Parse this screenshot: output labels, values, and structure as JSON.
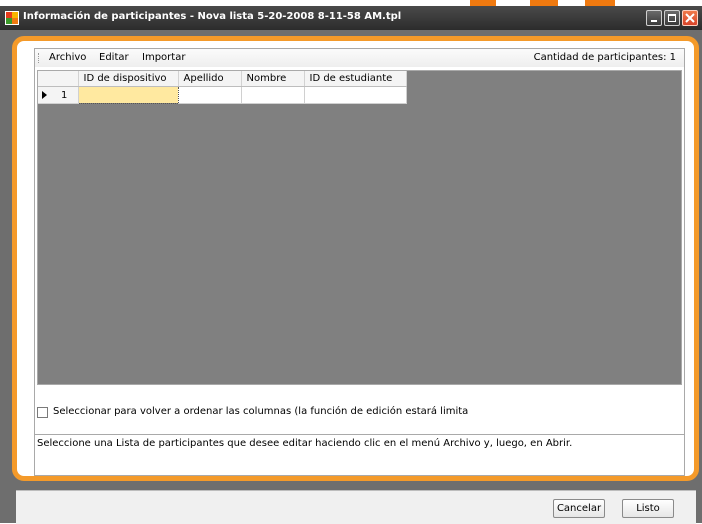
{
  "window": {
    "title": "Información de participantes - Nova lista 5-20-2008 8-11-58 AM.tpl",
    "accent_color": "#f49a2a",
    "titlebar_color": "#3a3a3a",
    "icons": {
      "app": "app-icon",
      "minimize": "minimize-icon",
      "maximize": "maximize-icon",
      "close": "close-icon"
    }
  },
  "menu": {
    "items": [
      "Archivo",
      "Editar",
      "Importar"
    ],
    "participant_count": "Cantidad de participantes: 1"
  },
  "grid": {
    "columns": [
      "ID de dispositivo",
      "Apellido",
      "Nombre",
      "ID de estudiante"
    ],
    "rows": [
      {
        "number": "1",
        "cells": [
          "",
          "",
          "",
          ""
        ],
        "selected_cell": 0
      }
    ]
  },
  "reorder": {
    "checked": false,
    "label": "Seleccionar para volver a ordenar las columnas (la función de edición estará limita"
  },
  "status": {
    "text": "Seleccione una Lista de participantes que desee editar haciendo clic en el menú Archivo y, luego, en Abrir."
  },
  "buttons": {
    "cancel": "Cancelar",
    "done": "Listo"
  }
}
